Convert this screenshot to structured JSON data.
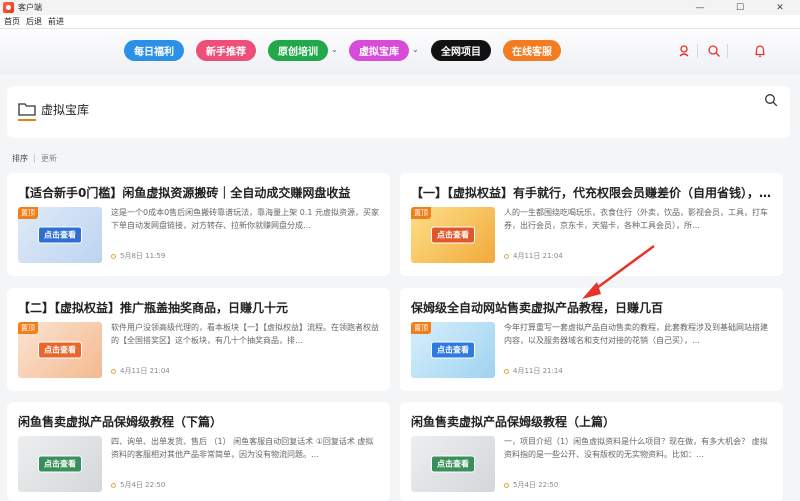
{
  "window": {
    "title": "客户端",
    "controls": [
      "—",
      "☐",
      "✕"
    ]
  },
  "menu": [
    "首页",
    "后退",
    "前进"
  ],
  "nav": {
    "buttons": [
      {
        "label": "每日福利",
        "color": "#2b91e8"
      },
      {
        "label": "新手推荐",
        "color": "#ee4f78"
      },
      {
        "label": "原创培训",
        "color": "#21a84b"
      },
      {
        "label": "虚拟宝库",
        "color": "#d84ad8"
      },
      {
        "label": "全网项目",
        "color": "#111111"
      },
      {
        "label": "在线客服",
        "color": "#f47b20"
      }
    ]
  },
  "panel": {
    "title": "虚拟宝库"
  },
  "sort": {
    "active": "排序",
    "other": "更新"
  },
  "cards": [
    {
      "title": "【适合新手0门槛】闲鱼虚拟资源搬砖｜全自动成交赚网盘收益",
      "desc": "这是一个0成本0售后闲鱼搬砖靠谱玩法，靠海量上架 0.1 元虚拟资源，买家下单自动发网盘链接，对方转存、拉新你就赚网盘分成…",
      "date": "5月8日 11:59",
      "thumb_label": "点击查看",
      "top_badge": "置顶"
    },
    {
      "title": "【一】【虚拟权益】有手就行，代充权限会员赚差价（自用省钱），…",
      "desc": "人的一生都围绕吃喝玩乐，衣食住行（外卖，饮品，影视会员，工具，打车券，出行会员，京东卡，天猫卡，各种工具会员），所…",
      "date": "4月11日 21:04",
      "thumb_label": "点击查看",
      "top_badge": "置顶"
    },
    {
      "title": "【二】【虚拟权益】推广瓶盖抽奖商品，日赚几十元",
      "desc": "软件用户没领高级代理的，看本板块【一】【虚拟权益】流程。在领跑者权益的【全国搭奖区】这个板块，有几十个抽奖商品，排…",
      "date": "4月11日 21:04",
      "thumb_label": "点击查看",
      "top_badge": "置顶"
    },
    {
      "title": "保姆级全自动网站售卖虚拟产品教程，日赚几百",
      "desc": "今年打算重写一套虚拟产品自动售卖的教程，此套教程涉及到基础网站搭建内容，以及服务器域名和支付对接的花销（自己买），…",
      "date": "4月11日 21:14",
      "thumb_label": "点击查看",
      "top_badge": "置顶"
    },
    {
      "title": "闲鱼售卖虚拟产品保姆级教程（下篇）",
      "desc": "四、询单、出单发货、售后 （1） 闲鱼客服自动回复话术 ①回复话术 虚拟资料的客服相对其他产品非常简单，因为没有物流问题。…",
      "date": "5月4日 22:50",
      "thumb_label": "点击查看",
      "top_badge": ""
    },
    {
      "title": "闲鱼售卖虚拟产品保姆级教程（上篇）",
      "desc": "一，项目介绍（1）闲鱼虚拟资料是什么项目？现在做，有多大机会？ 虚拟资料指的是一些公开、没有版权的无实物资料。比如：…",
      "date": "5月4日 22:50",
      "thumb_label": "点击查看",
      "top_badge": ""
    }
  ],
  "arrow_color": "#e8322a"
}
